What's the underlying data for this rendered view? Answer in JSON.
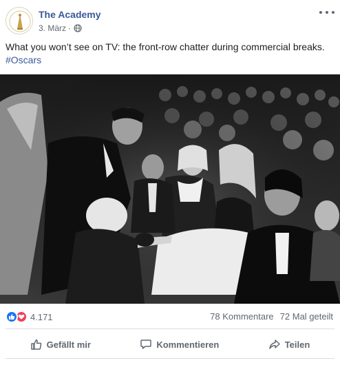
{
  "header": {
    "page_name": "The Academy",
    "date": "3. März",
    "separator": "·",
    "privacy_icon": "globe-icon",
    "more_icon": "more-options-icon"
  },
  "post": {
    "text": "What you won’t see on TV: the front-row chatter during commercial breaks.",
    "hashtag": "#Oscars",
    "photo_description_icon": "photo"
  },
  "stats": {
    "reaction_icons": [
      "like-icon",
      "love-icon"
    ],
    "reaction_count": "4.171",
    "comments": "78 Kommentare",
    "shares": "72 Mal geteilt"
  },
  "actions": {
    "like_label": "Gefällt mir",
    "comment_label": "Kommentieren",
    "share_label": "Teilen"
  },
  "colors": {
    "link": "#385898",
    "secondary_text": "#606770",
    "like_blue": "#1877f2",
    "love_red": "#f33e58",
    "divider": "#dadde1",
    "oscar_gold": "#c9a24a"
  }
}
